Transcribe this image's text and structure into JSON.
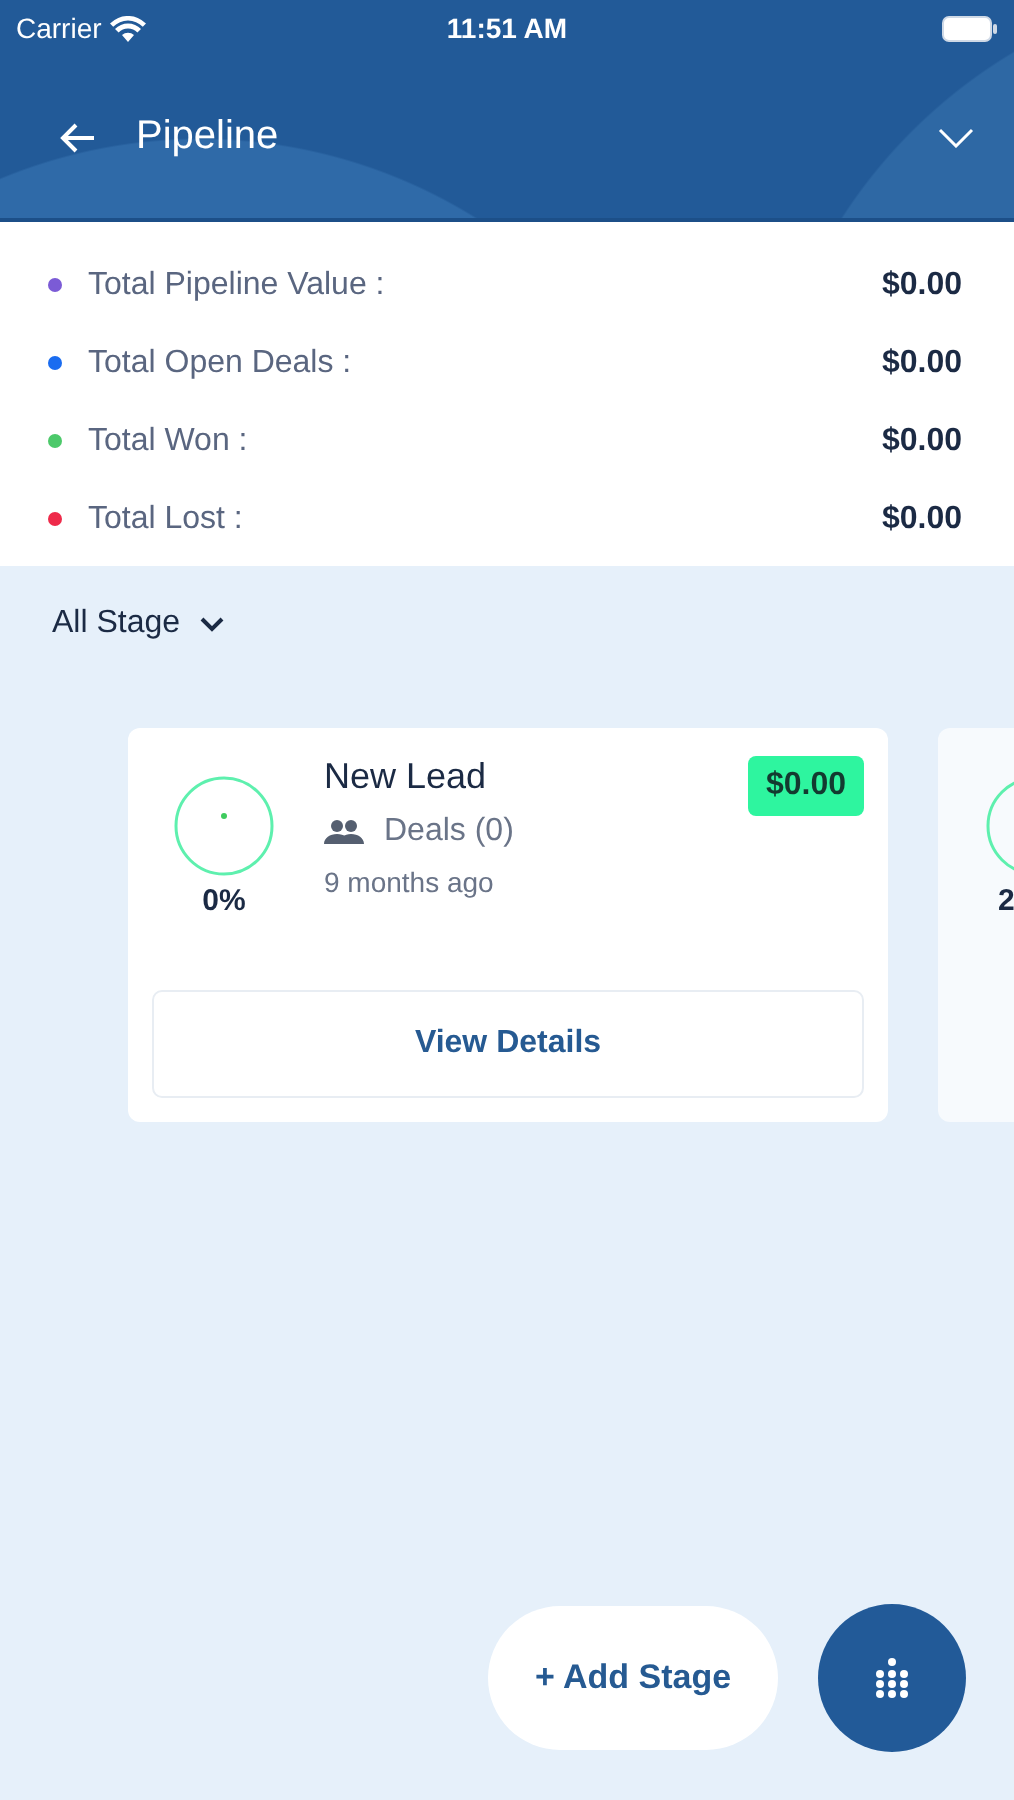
{
  "status_bar": {
    "carrier": "Carrier",
    "time": "11:51 AM"
  },
  "header": {
    "title": "Pipeline"
  },
  "summary": [
    {
      "label": "Total Pipeline Value :",
      "value": "$0.00",
      "color": "#7b5bd6"
    },
    {
      "label": "Total Open Deals :",
      "value": "$0.00",
      "color": "#1a6cf0"
    },
    {
      "label": "Total Won :",
      "value": "$0.00",
      "color": "#4cc96a"
    },
    {
      "label": "Total Lost :",
      "value": "$0.00",
      "color": "#ee2a4a"
    }
  ],
  "filter": {
    "label": "All Stage"
  },
  "stages": [
    {
      "kind": "full",
      "name": "New Lead",
      "deals": "Deals (0)",
      "time": "9 months ago",
      "amount": "$0.00",
      "percent": "0%",
      "action": "View Details"
    },
    {
      "kind": "partial",
      "percent": "2"
    }
  ],
  "add_button": "+ Add Stage"
}
